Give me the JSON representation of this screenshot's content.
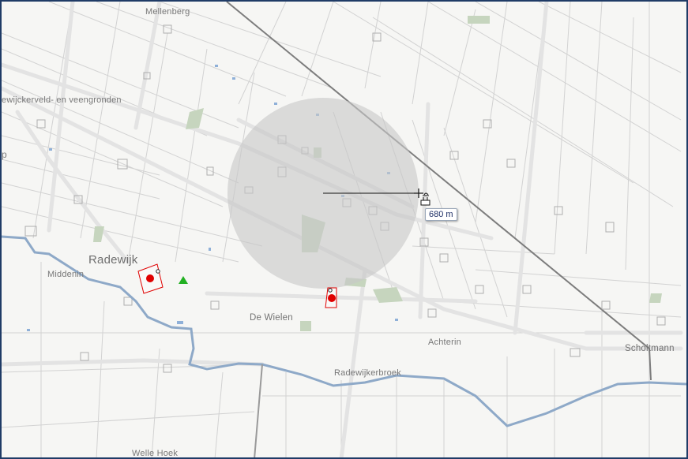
{
  "map": {
    "place_labels": [
      {
        "id": "mellenberg",
        "text": "Mellenberg"
      },
      {
        "id": "veengronden",
        "text": "ewijckerveld- en veengronden"
      },
      {
        "id": "p",
        "text": "p"
      },
      {
        "id": "radewijk",
        "text": "Radewijk"
      },
      {
        "id": "middenin",
        "text": "Middenin"
      },
      {
        "id": "de-wielen",
        "text": "De Wielen"
      },
      {
        "id": "achterin",
        "text": "Achterin"
      },
      {
        "id": "radewijkerbroek",
        "text": "Radewijkerbroek"
      },
      {
        "id": "scholtmann",
        "text": "Scholtmann"
      },
      {
        "id": "welle-hoek",
        "text": "Welle Hoek"
      }
    ],
    "measure": {
      "radius_label": "680 m"
    },
    "colors": {
      "background": "#f6f6f4",
      "road": "#e3e3e3",
      "parcel_line": "#d2d2d2",
      "water": "#8ea9c8",
      "circle_fill": "#c8c8c8",
      "marker_red": "#e00000",
      "marker_green": "#22b022",
      "railway": "#7d7d7d",
      "frame": "#1f3b66"
    }
  }
}
